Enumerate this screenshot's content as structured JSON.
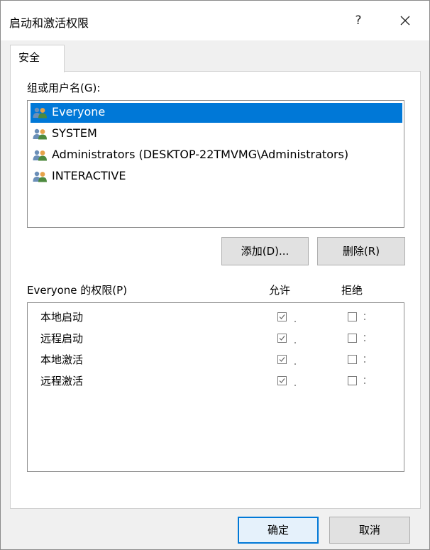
{
  "window": {
    "title": "启动和激活权限",
    "help_label": "?"
  },
  "tabs": [
    {
      "label": "安全"
    }
  ],
  "group": {
    "label": "组或用户名(G):",
    "items": [
      {
        "name": "Everyone",
        "selected": true
      },
      {
        "name": "SYSTEM",
        "selected": false
      },
      {
        "name": "Administrators (DESKTOP-22TMVMG\\Administrators)",
        "selected": false
      },
      {
        "name": "INTERACTIVE",
        "selected": false
      }
    ]
  },
  "buttons": {
    "add": "添加(D)...",
    "remove": "删除(R)",
    "ok": "确定",
    "cancel": "取消"
  },
  "permissions": {
    "label": "Everyone 的权限(P)",
    "allow_header": "允许",
    "deny_header": "拒绝",
    "rows": [
      {
        "name": "本地启动",
        "allow": true,
        "deny": false
      },
      {
        "name": "远程启动",
        "allow": true,
        "deny": false
      },
      {
        "name": "本地激活",
        "allow": true,
        "deny": false
      },
      {
        "name": "远程激活",
        "allow": true,
        "deny": false
      }
    ]
  },
  "colors": {
    "selection": "#0078d7",
    "dialog_bg": "#f0f0f0",
    "panel_bg": "#ffffff"
  },
  "icons": {
    "user_group": "users-icon",
    "close": "close-icon",
    "check": "checkmark-icon"
  }
}
